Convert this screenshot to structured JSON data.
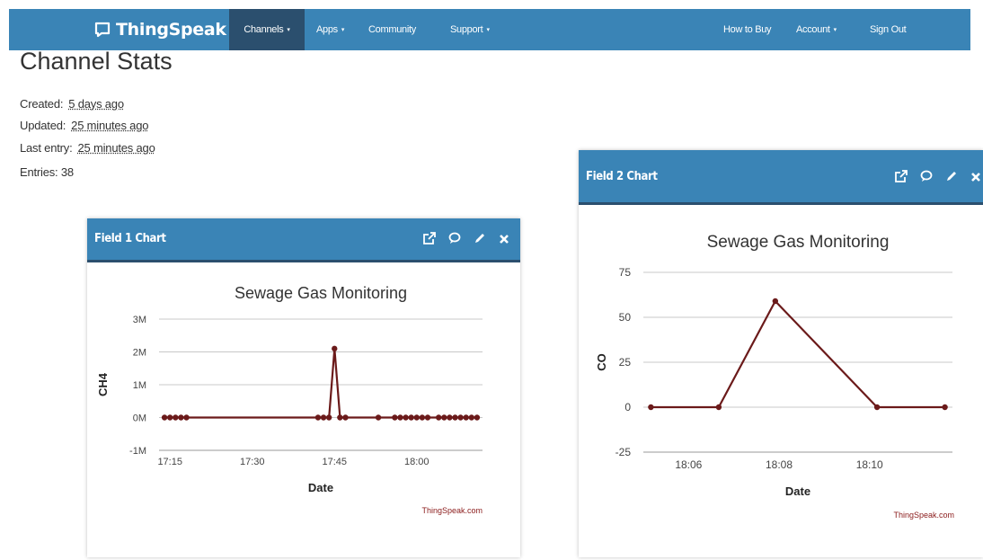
{
  "nav": {
    "brand": "ThingSpeak",
    "brand_tm": "™",
    "items": [
      {
        "label": "Channels",
        "active": true,
        "caret": "▾"
      },
      {
        "label": "Apps",
        "caret": "▾"
      },
      {
        "label": "Community"
      },
      {
        "label": "Support",
        "caret": "▾"
      },
      {
        "label": "How to Buy"
      },
      {
        "label": "Account",
        "caret": "▾"
      },
      {
        "label": "Sign Out"
      }
    ]
  },
  "page": {
    "title": "Channel Stats",
    "created_label": "Created:",
    "created_value": "5 days ago",
    "updated_label": "Updated:",
    "updated_value": "25 minutes ago",
    "last_entry_label": "Last entry:",
    "last_entry_value": "25 minutes ago",
    "entries_label": "Entries:",
    "entries_value": "38"
  },
  "colors": {
    "nav_bg": "#3a84b6",
    "nav_active": "#2b4f6e",
    "series": "#6b1a1a"
  },
  "panel_icons": [
    "external-link-icon",
    "comment-icon",
    "pencil-icon",
    "close-icon"
  ],
  "panels": [
    {
      "title": "Field 1 Chart",
      "chart_data": {
        "type": "line",
        "title": "Sewage Gas Monitoring",
        "xlabel": "Date",
        "ylabel": "CH4",
        "credit": "ThingSpeak.com",
        "ylim": [
          -1000000,
          3000000
        ],
        "yticks": [
          -1000000,
          0,
          1000000,
          2000000,
          3000000
        ],
        "ytick_labels": [
          "-1M",
          "0M",
          "1M",
          "2M",
          "3M"
        ],
        "xlim": [
          "17:13",
          "18:12"
        ],
        "xticks": [
          "17:15",
          "17:30",
          "17:45",
          "18:00"
        ],
        "grid": true,
        "series": [
          {
            "points": [
              [
                "17:14",
                0
              ],
              [
                "17:15",
                0
              ],
              [
                "17:16",
                0
              ],
              [
                "17:17",
                0
              ],
              [
                "17:18",
                0
              ],
              [
                "17:42",
                0
              ],
              [
                "17:43",
                0
              ],
              [
                "17:44",
                0
              ],
              [
                "17:45",
                2100000
              ],
              [
                "17:46",
                0
              ],
              [
                "17:47",
                0
              ],
              [
                "17:53",
                0
              ],
              [
                "17:56",
                0
              ],
              [
                "17:57",
                0
              ],
              [
                "17:58",
                0
              ],
              [
                "17:59",
                0
              ],
              [
                "18:00",
                0
              ],
              [
                "18:01",
                0
              ],
              [
                "18:02",
                0
              ],
              [
                "18:04",
                0
              ],
              [
                "18:05",
                0
              ],
              [
                "18:06",
                0
              ],
              [
                "18:07",
                0
              ],
              [
                "18:08",
                0
              ],
              [
                "18:09",
                0
              ],
              [
                "18:10",
                0
              ],
              [
                "18:11",
                0
              ]
            ]
          }
        ]
      }
    },
    {
      "title": "Field 2 Chart",
      "chart_data": {
        "type": "line",
        "title": "Sewage Gas Monitoring",
        "xlabel": "Date",
        "ylabel": "CO",
        "credit": "ThingSpeak.com",
        "ylim": [
          -25,
          75
        ],
        "yticks": [
          -25,
          0,
          25,
          50,
          75
        ],
        "ytick_labels": [
          "-25",
          "0",
          "25",
          "50",
          "75"
        ],
        "xlim": [
          "18:05:00",
          "18:11:50"
        ],
        "xticks": [
          "18:06",
          "18:08",
          "18:10"
        ],
        "grid": true,
        "series": [
          {
            "points": [
              [
                "18:05:10",
                0
              ],
              [
                "18:06:40",
                0
              ],
              [
                "18:07:55",
                59
              ],
              [
                "18:10:10",
                0
              ],
              [
                "18:11:40",
                0
              ]
            ]
          }
        ]
      }
    }
  ]
}
